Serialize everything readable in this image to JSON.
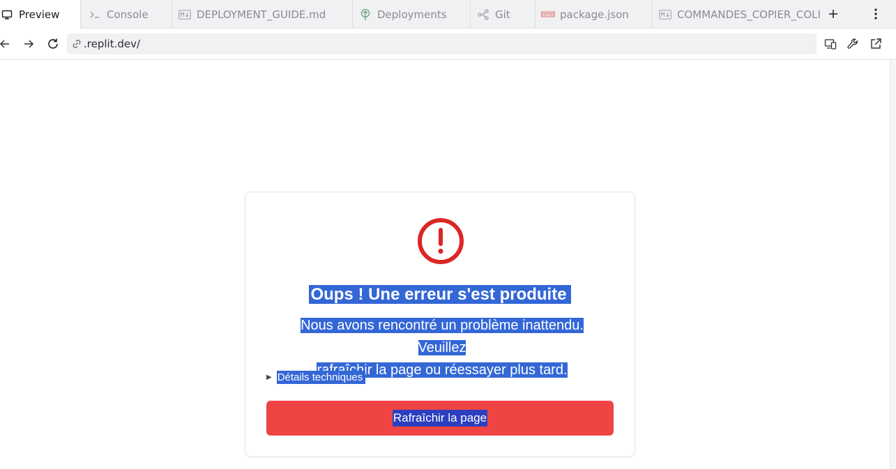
{
  "tabs": [
    {
      "label": "Preview",
      "icon": "monitor-icon",
      "active": true
    },
    {
      "label": "Console",
      "icon": "terminal-icon",
      "active": false
    },
    {
      "label": "DEPLOYMENT_GUIDE.md",
      "icon": "markdown-icon",
      "active": false
    },
    {
      "label": "Deployments",
      "icon": "deploy-icon",
      "active": false
    },
    {
      "label": "Git",
      "icon": "git-icon",
      "active": false
    },
    {
      "label": "package.json",
      "icon": "npm-icon",
      "active": false
    },
    {
      "label": "COMMANDES_COPIER_COLI",
      "icon": "markdown-icon",
      "active": false
    }
  ],
  "address_bar": {
    "url": ".replit.dev/"
  },
  "error_card": {
    "title": "Oups ! Une erreur s'est produite",
    "message_line1": "Nous avons rencontré un problème inattendu. Veuillez",
    "message_line2": "rafraîchir la page ou réessayer plus tard.",
    "details_label": "Détails techniques",
    "refresh_button": "Rafraîchir la page"
  },
  "colors": {
    "error_icon": "#dc2626",
    "button_bg": "#ef4444",
    "selection": "#3367d6"
  }
}
